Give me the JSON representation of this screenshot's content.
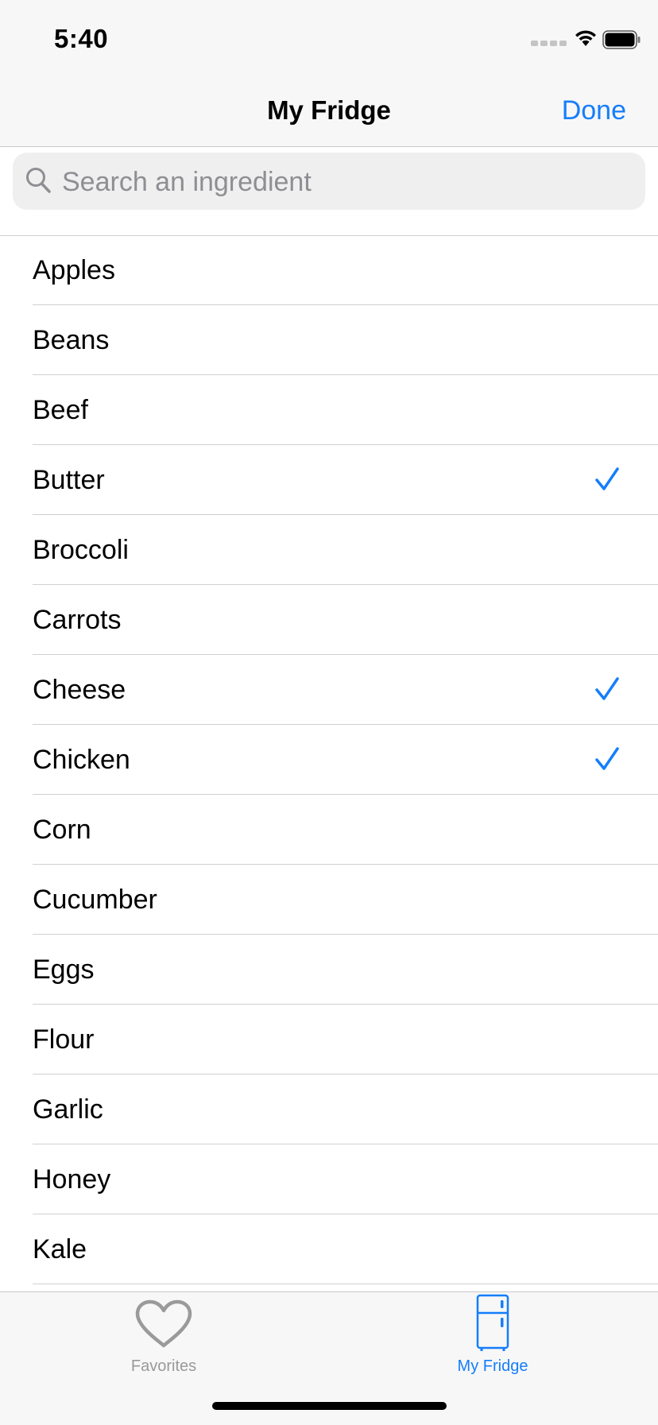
{
  "status_bar": {
    "time": "5:40"
  },
  "nav": {
    "title": "My Fridge",
    "done_label": "Done"
  },
  "search": {
    "placeholder": "Search an ingredient"
  },
  "ingredients": [
    {
      "label": "Apples",
      "checked": false
    },
    {
      "label": "Beans",
      "checked": false
    },
    {
      "label": "Beef",
      "checked": false
    },
    {
      "label": "Butter",
      "checked": true
    },
    {
      "label": "Broccoli",
      "checked": false
    },
    {
      "label": "Carrots",
      "checked": false
    },
    {
      "label": "Cheese",
      "checked": true
    },
    {
      "label": "Chicken",
      "checked": true
    },
    {
      "label": "Corn",
      "checked": false
    },
    {
      "label": "Cucumber",
      "checked": false
    },
    {
      "label": "Eggs",
      "checked": false
    },
    {
      "label": "Flour",
      "checked": false
    },
    {
      "label": "Garlic",
      "checked": false
    },
    {
      "label": "Honey",
      "checked": false
    },
    {
      "label": "Kale",
      "checked": false
    }
  ],
  "tab_bar": {
    "tabs": [
      {
        "label": "Favorites",
        "icon": "heart-icon",
        "selected": false
      },
      {
        "label": "My Fridge",
        "icon": "fridge-icon",
        "selected": true
      }
    ]
  },
  "colors": {
    "accent": "#147efb",
    "inactive_tab": "#999999",
    "bar_background": "#f7f7f7",
    "separator": "#d0d0d4"
  }
}
